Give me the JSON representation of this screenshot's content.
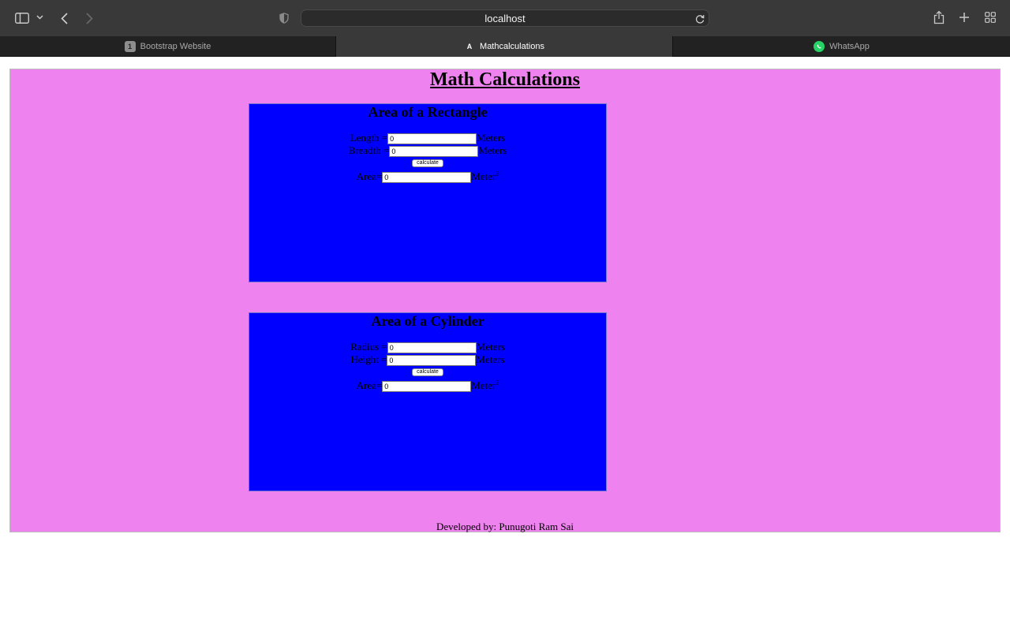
{
  "browser": {
    "address": "localhost",
    "tabs": [
      {
        "label": "Bootstrap Website",
        "favicon_text": "1"
      },
      {
        "label": "Mathcalculations",
        "favicon_text": "A"
      },
      {
        "label": "WhatsApp",
        "favicon_text": ""
      }
    ]
  },
  "page": {
    "title": "Math Calculations",
    "rectangle": {
      "title": "Area of a Rectangle",
      "length_label": "Length =",
      "length_value": "0",
      "breadth_label": "Breadth =",
      "breadth_value": "0",
      "unit": "Meters",
      "button_label": "calculate",
      "area_label": "Area=",
      "area_value": "0",
      "area_unit": "Meter",
      "area_unit_sup": "2"
    },
    "cylinder": {
      "title": "Area of a Cylinder",
      "radius_label": "Radius =",
      "radius_value": "0",
      "height_label": "Height =",
      "height_value": "0",
      "unit": "Meters",
      "button_label": "calculate",
      "area_label": "Area=",
      "area_value": "0",
      "area_unit": "Meter",
      "area_unit_sup": "2"
    },
    "footer": "Developed by: Punugoti Ram Sai"
  },
  "colors": {
    "page_bg": "#ee82ee",
    "card_bg": "#0000ff",
    "chrome_bg": "#3a3939"
  }
}
